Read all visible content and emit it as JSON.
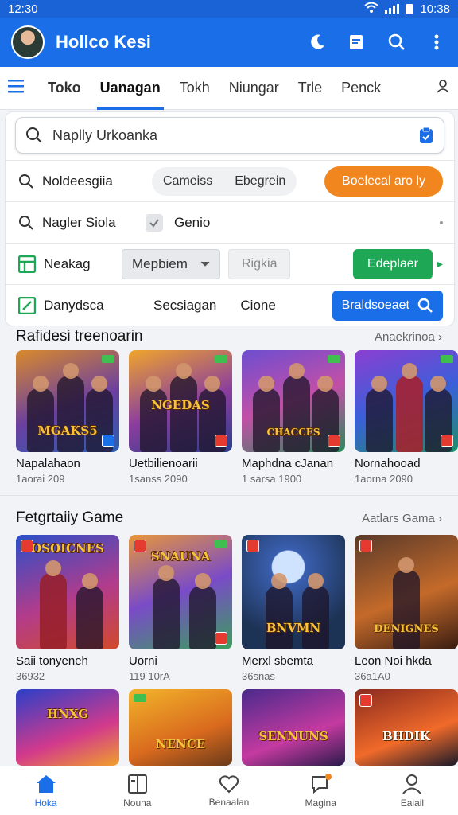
{
  "status": {
    "time": "12:30",
    "clock": "10:38"
  },
  "appbar": {
    "title": "Hollco Kesi"
  },
  "tabs": [
    "Toko",
    "Uanagan",
    "Tokh",
    "Niungar",
    "Trle",
    "Penck"
  ],
  "search": {
    "value": "Naplly Urkoanka"
  },
  "filters": {
    "row1": {
      "label": "Noldeesgiia",
      "pill1": "Cameiss",
      "pill2": "Ebegrein",
      "button": "Boelecal aro ly"
    },
    "row2": {
      "label": "Nagler Siola",
      "check_label": "Genio"
    },
    "row3": {
      "label": "Neakag",
      "select": "Mepbiem",
      "ghost": "Rigkia",
      "button": "Edeplaer"
    },
    "row4": {
      "label": "Danydsca",
      "link1": "Secsiagan",
      "link2": "Cione",
      "button": "Braldsoeaet"
    }
  },
  "section1": {
    "title": "Rafidesi treenoarin",
    "more": "Anaekrinoa",
    "cards": [
      {
        "name": "Napalahaon",
        "sub": "1aorai 209",
        "logo": "MGAKS5"
      },
      {
        "name": "Uetbilienoarii",
        "sub": "1sanss 2090",
        "logo": "NGEDAS"
      },
      {
        "name": "Maphdna cJanan",
        "sub": "1 sarsa 1900",
        "logo": "CHACCES"
      },
      {
        "name": "Nornahooad",
        "sub": "1aorna 2090",
        "logo": ""
      }
    ]
  },
  "section2": {
    "title": "Fetgrtaiiy Game",
    "more": "Aatlars Gama",
    "cards": [
      {
        "name": "Saii tonyeneh",
        "sub": "36932",
        "logo": "OSOICNES"
      },
      {
        "name": "Uorni",
        "sub": "119 10rA",
        "logo": "SNAUNA"
      },
      {
        "name": "Merxl sbemta",
        "sub": "36snas",
        "logo": "BNVMN"
      },
      {
        "name": "Leon Noi hkda",
        "sub": "36a1A0",
        "logo": "DENIGNES"
      }
    ]
  },
  "section3": {
    "cards": [
      {
        "logo": "HNXG"
      },
      {
        "logo": "NENCE"
      },
      {
        "logo": "SENNUNS"
      },
      {
        "logo": "BHDIK"
      }
    ]
  },
  "bottomnav": [
    "Hoka",
    "Nouna",
    "Benaalan",
    "Magina",
    "Eaiail"
  ],
  "colors": {
    "primary": "#1a6ee8",
    "orange": "#f2861e",
    "green": "#1ea856"
  }
}
